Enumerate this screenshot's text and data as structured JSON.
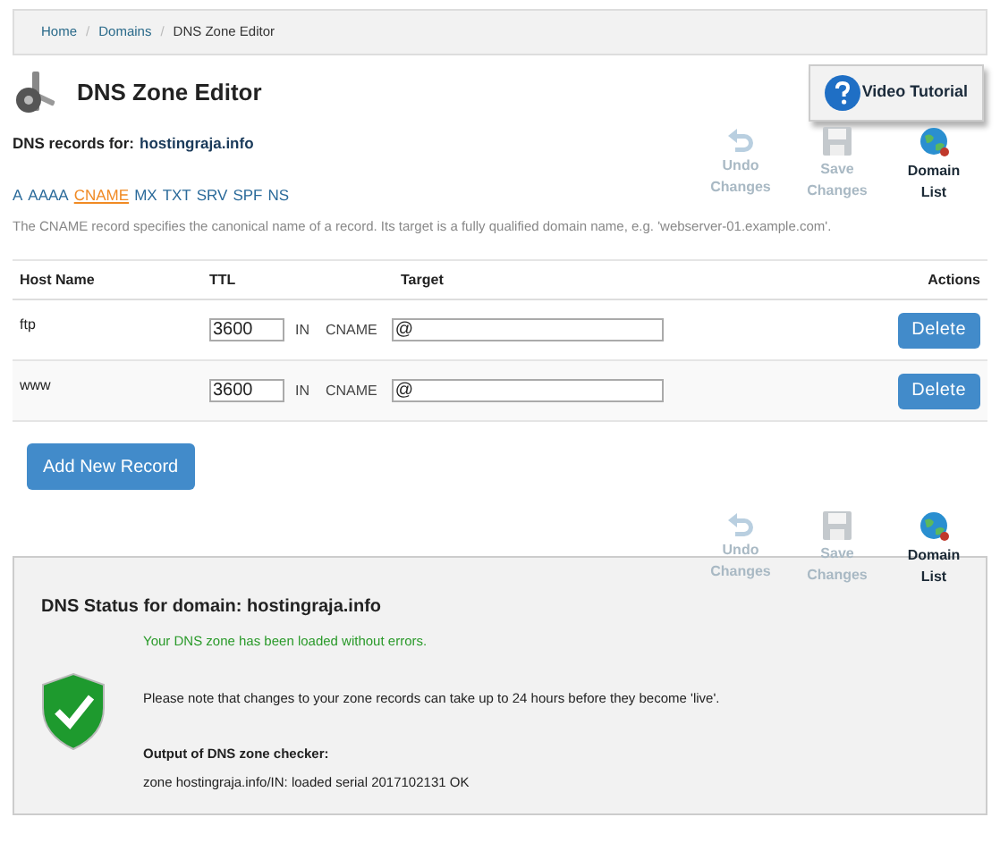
{
  "breadcrumb": [
    {
      "label": "Home",
      "current": false
    },
    {
      "separator": "/",
      "label": "Domains",
      "current": false
    },
    {
      "separator": "/",
      "label": "DNS Zone Editor",
      "current": true
    }
  ],
  "title": "DNS Zone Editor",
  "video_button": "Video Tutorial",
  "records_for": {
    "label": "DNS records for:",
    "domain": "hostingraja.info"
  },
  "toolbar_top": [
    {
      "kind": "undo",
      "label": "Undo Changes",
      "disabled": true
    },
    {
      "kind": "save",
      "label": "Save Changes",
      "disabled": true
    },
    {
      "kind": "domains",
      "label": "Domain List",
      "disabled": false
    }
  ],
  "record_types": [
    {
      "label": "A",
      "selected": false
    },
    {
      "label": "AAAA",
      "selected": false
    },
    {
      "label": "CNAME",
      "selected": true
    },
    {
      "label": "MX",
      "selected": false
    },
    {
      "label": "TXT",
      "selected": false
    },
    {
      "label": "SRV",
      "selected": false
    },
    {
      "label": "SPF",
      "selected": false
    },
    {
      "label": "NS",
      "selected": false
    }
  ],
  "description": "The CNAME record specifies the canonical name of a record. Its target is a fully qualified domain name, e.g. 'webserver-01.example.com'.",
  "table": {
    "columns": [
      "Host Name",
      "TTL",
      "Target",
      "Actions"
    ],
    "rows": [
      {
        "host": "ftp",
        "ttl": "3600",
        "class": "IN",
        "type": "CNAME",
        "target": "@",
        "action": "Delete"
      },
      {
        "host": "www",
        "ttl": "3600",
        "class": "IN",
        "type": "CNAME",
        "target": "@",
        "action": "Delete"
      }
    ]
  },
  "add_button": "Add New Record",
  "toolbar_bottom": [
    {
      "kind": "undo",
      "label": "Undo Changes",
      "disabled": true
    },
    {
      "kind": "save",
      "label": "Save Changes",
      "disabled": true
    },
    {
      "kind": "domains",
      "label": "Domain List",
      "disabled": false
    }
  ],
  "status": {
    "title": "DNS Status for domain: hostingraja.info",
    "success": "Your DNS zone has been loaded without errors.",
    "note": "Please note that changes to your zone records can take up to 24 hours before they become 'live'.",
    "output_label": "Output of DNS zone checker:",
    "output": "zone hostingraja.info/IN: loaded serial 2017102131 OK"
  }
}
